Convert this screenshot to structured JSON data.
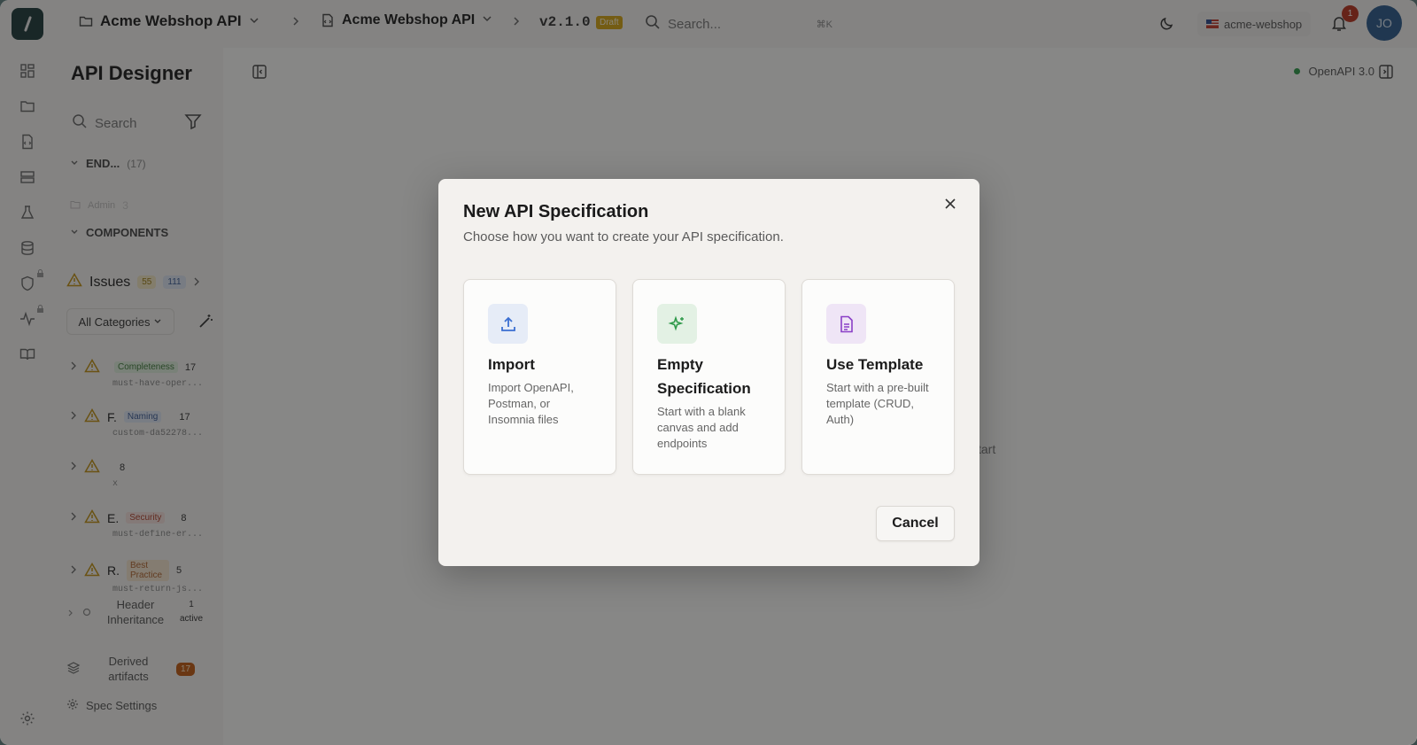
{
  "topbar": {
    "project": "Acme Webshop API",
    "api": "Acme Webshop API",
    "version": "v2.1.0",
    "status_badge": "Draft",
    "search_placeholder": "Search...",
    "search_shortcut": "⌘K",
    "workspace": "acme-webshop",
    "notifications_count": "1",
    "avatar_initials": "JO"
  },
  "sidebar": {
    "title": "API Designer",
    "search_placeholder": "Search",
    "endpoints_label": "END...",
    "endpoints_count": "(17)",
    "admin_label": "Admin",
    "admin_count": "3",
    "components_label": "COMPONENTS",
    "issues_label": "Issues",
    "issues_warnings": "55",
    "issues_info": "111",
    "category_filter": "All Categories",
    "issue_items": [
      {
        "letter": "",
        "tag": "Completeness",
        "count": "17",
        "rule": "must-have-oper..."
      },
      {
        "letter": "F.",
        "tag": "Naming",
        "count": "17",
        "rule": "custom-da52278..."
      },
      {
        "letter": "",
        "tag": "",
        "count": "8",
        "rule": "x"
      },
      {
        "letter": "E.",
        "tag": "Security",
        "count": "8",
        "rule": "must-define-er..."
      },
      {
        "letter": "R.",
        "tag": "Best Practice",
        "count": "5",
        "rule": "must-return-js..."
      }
    ],
    "header_inheritance_label": "Header Inheritance",
    "header_inheritance_count": "1",
    "header_inheritance_status": "active",
    "derived_label": "Derived artifacts",
    "derived_count": "17",
    "spec_settings": "Spec Settings"
  },
  "main": {
    "openapi_version": "OpenAPI 3.0",
    "start_hint": "tart"
  },
  "modal": {
    "title": "New API Specification",
    "description": "Choose how you want to create your API specification.",
    "options": [
      {
        "title": "Import",
        "description": "Import OpenAPI, Postman, or Insomnia files",
        "icon": "upload-icon",
        "color": "#3b6fd1",
        "bg": "#e6ecf7"
      },
      {
        "title": "Empty Specification",
        "description": "Start with a blank canvas and add endpoints",
        "icon": "sparkle-icon",
        "color": "#2f9a4a",
        "bg": "#e3f1e4"
      },
      {
        "title": "Use Template",
        "description": "Start with a pre-built template (CRUD, Auth)",
        "icon": "document-icon",
        "color": "#8a3fc7",
        "bg": "#efe5f6"
      }
    ],
    "cancel_label": "Cancel"
  }
}
